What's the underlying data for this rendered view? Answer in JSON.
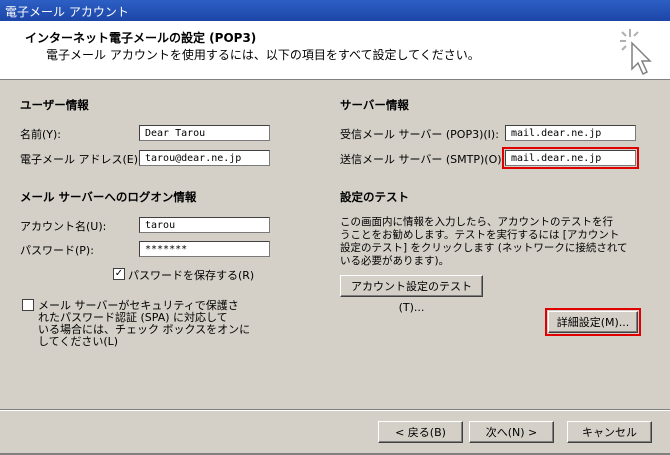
{
  "window": {
    "title": "電子メール アカウント"
  },
  "header": {
    "title": "インターネット電子メールの設定 (POP3)",
    "subtitle": "電子メール アカウントを使用するには、以下の項目をすべて設定してください。"
  },
  "user_info": {
    "heading": "ユーザー情報",
    "name_label": "名前(Y):",
    "name_value": "Dear Tarou",
    "email_label": "電子メール アドレス(E):",
    "email_value": "tarou@dear.ne.jp"
  },
  "logon_info": {
    "heading": "メール サーバーへのログオン情報",
    "account_label": "アカウント名(U):",
    "account_value": "tarou",
    "password_label": "パスワード(P):",
    "password_value": "*******",
    "save_password_label": "パスワードを保存する(R)",
    "spa_label_1": "メール サーバーがセキュリティで保護さ",
    "spa_label_2": "れたパスワード認証 (SPA) に対応して",
    "spa_label_3": "いる場合には、チェック ボックスをオンに",
    "spa_label_4": "してください(L)"
  },
  "server_info": {
    "heading": "サーバー情報",
    "incoming_label": "受信メール サーバー (POP3)(I):",
    "incoming_value": "mail.dear.ne.jp",
    "outgoing_label": "送信メール サーバー (SMTP)(O):",
    "outgoing_value": "mail.dear.ne.jp"
  },
  "test": {
    "heading": "設定のテスト",
    "desc_1": "この画面内に情報を入力したら、アカウントのテストを行",
    "desc_2": "うことをお勧めします。テストを実行するには [アカウント",
    "desc_3": "設定のテスト] をクリックします (ネットワークに接続されて",
    "desc_4": "いる必要があります)。",
    "test_button": "アカウント設定のテスト(T)...",
    "advanced_button": "詳細設定(M)..."
  },
  "footer": {
    "back_button": "< 戻る(B)",
    "next_button": "次へ(N) >",
    "cancel_button": "キャンセル"
  }
}
